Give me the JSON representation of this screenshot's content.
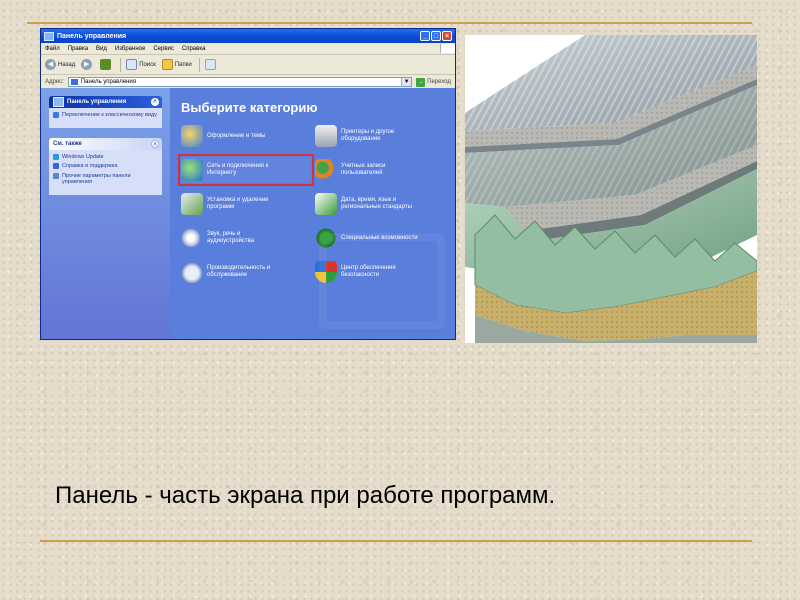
{
  "window": {
    "title": "Панель управления",
    "menu": [
      "Файл",
      "Правка",
      "Вид",
      "Избранное",
      "Сервис",
      "Справка"
    ],
    "toolbar": {
      "back": "Назад",
      "search": "Поиск",
      "folders": "Папки"
    },
    "address": {
      "label": "Адрес:",
      "value": "Панель управления",
      "go": "Переход"
    },
    "sidebar": {
      "panel_title": "Панель управления",
      "switch_link": "Переключение к классическому виду",
      "see_also_title": "См. также",
      "see_also": [
        "Windows Update",
        "Справка и поддержка",
        "Прочие параметры панели управления"
      ]
    },
    "main": {
      "heading": "Выберите категорию",
      "categories": [
        {
          "label": "Оформление и темы",
          "icon": "appearance-icon"
        },
        {
          "label": "Принтеры и другое оборудование",
          "icon": "printer-icon"
        },
        {
          "label": "Сеть и подключения к Интернету",
          "icon": "network-icon",
          "highlighted": true
        },
        {
          "label": "Учетные записи пользователей",
          "icon": "users-icon"
        },
        {
          "label": "Установка и удаление программ",
          "icon": "install-icon"
        },
        {
          "label": "Дата, время, язык и региональные стандарты",
          "icon": "calendar-icon"
        },
        {
          "label": "Звук, речь и аудиоустройства",
          "icon": "sound-icon"
        },
        {
          "label": "Специальные возможности",
          "icon": "accessibility-icon"
        },
        {
          "label": "Производительность и обслуживание",
          "icon": "performance-icon"
        },
        {
          "label": "Центр обеспечения безопасности",
          "icon": "security-shield-icon"
        }
      ]
    }
  },
  "caption": "Панель - часть экрана при работе программ.",
  "colors": {
    "accent_rule": "#c9a14a",
    "xp_blue": "#0054e3",
    "highlight": "#d13438"
  }
}
